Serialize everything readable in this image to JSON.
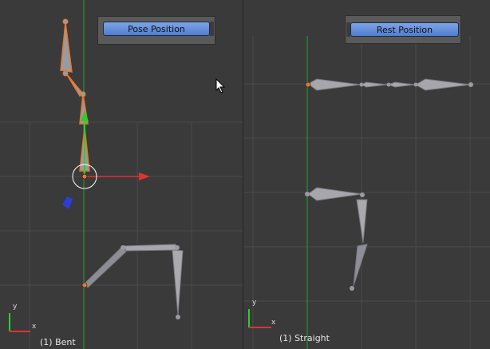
{
  "left_viewport": {
    "button_label": "Pose Position",
    "object_label": "(1) Bent",
    "axis_y": "y",
    "axis_x": "x"
  },
  "right_viewport": {
    "button_label": "Rest Position",
    "object_label": "(1) Straight",
    "axis_y": "y",
    "axis_x": "x"
  },
  "colors": {
    "viewport_bg": "#3a3a3a",
    "grid": "#4a4a4a",
    "y_axis": "#2e9c2e",
    "bone": "#a9a9ae",
    "bone_selected_outline": "#e8782a",
    "button": "#5f88d6"
  }
}
